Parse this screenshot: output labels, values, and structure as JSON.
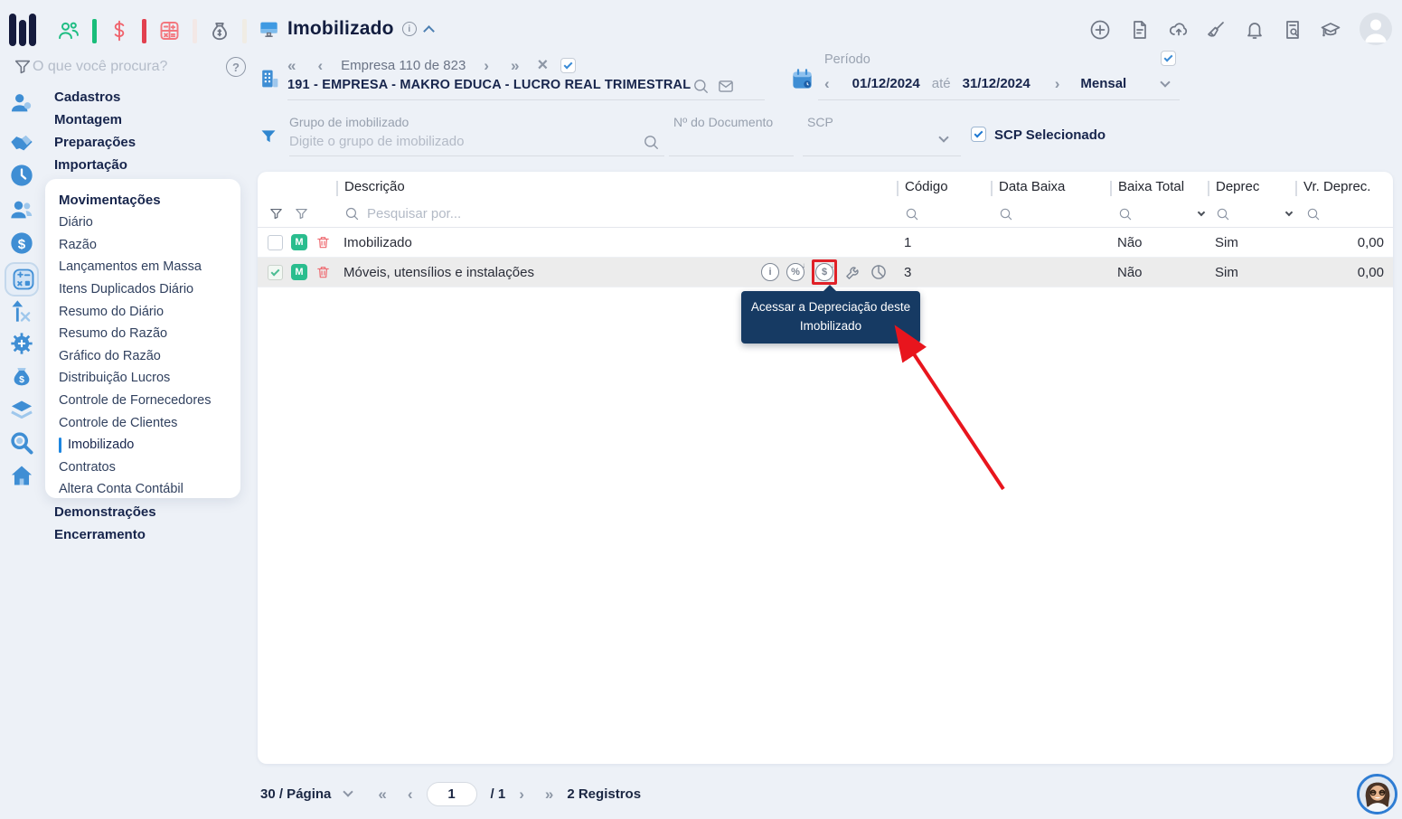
{
  "glyphs": {
    "double_left": "«",
    "left": "‹",
    "right": "›",
    "double_right": "»",
    "close": "×",
    "question": "?",
    "info": "i",
    "percent": "%",
    "dollar": "$"
  },
  "sidebar": {
    "search_placeholder": "O que você procura?",
    "top_items": [
      "Cadastros",
      "Montagem",
      "Preparações",
      "Importação"
    ],
    "movimentacoes": {
      "label": "Movimentações",
      "items": [
        "Diário",
        "Razão",
        "Lançamentos em Massa",
        "Itens Duplicados Diário",
        "Resumo do Diário",
        "Resumo do Razão",
        "Gráfico do Razão",
        "Distribuição Lucros",
        "Controle de Fornecedores",
        "Controle de Clientes",
        "Imobilizado",
        "Contratos",
        "Altera Conta Contábil"
      ],
      "active_item": "Imobilizado"
    },
    "bottom_items": [
      "Demonstrações",
      "Encerramento"
    ]
  },
  "header": {
    "title": "Imobilizado",
    "company": {
      "counter": "Empresa 110 de 823",
      "name": "191 - EMPRESA - MAKRO EDUCA - LUCRO REAL TRIMESTRAL"
    },
    "period": {
      "label": "Período",
      "start": "01/12/2024",
      "between": "até",
      "end": "31/12/2024",
      "mode": "Mensal"
    }
  },
  "filters": {
    "group_label": "Grupo de imobilizado",
    "group_placeholder": "Digite o grupo de imobilizado",
    "document_label": "Nº do Documento",
    "scp_label": "SCP",
    "scp_selected_label": "SCP Selecionado",
    "scp_selected_checked": true
  },
  "table": {
    "columns": [
      "Descrição",
      "Código",
      "Data Baixa",
      "Baixa Total",
      "Deprec",
      "Vr. Deprec."
    ],
    "search_placeholder": "Pesquisar por...",
    "row_badge": "M",
    "rows": [
      {
        "description": "Imobilizado",
        "code": "1",
        "data_baixa": "",
        "baixa_total": "Não",
        "deprec": "Sim",
        "vr_deprec": "0,00",
        "selected": false
      },
      {
        "description": "Móveis, utensílios e instalações",
        "code": "3",
        "data_baixa": "",
        "baixa_total": "Não",
        "deprec": "Sim",
        "vr_deprec": "0,00",
        "selected": true
      }
    ],
    "tooltip": {
      "line1": "Acessar a Depreciação deste",
      "line2": "Imobilizado"
    }
  },
  "pagination": {
    "per_page": "30 / Página",
    "page": "1",
    "of_pages": "/ 1",
    "records": "2 Registros"
  },
  "colors": {
    "accent_blue": "#3f8ed4",
    "green": "#2abd8e",
    "red": "#ee6a70",
    "tooltip_bg": "#163a63",
    "highlight_red": "#e02128"
  }
}
